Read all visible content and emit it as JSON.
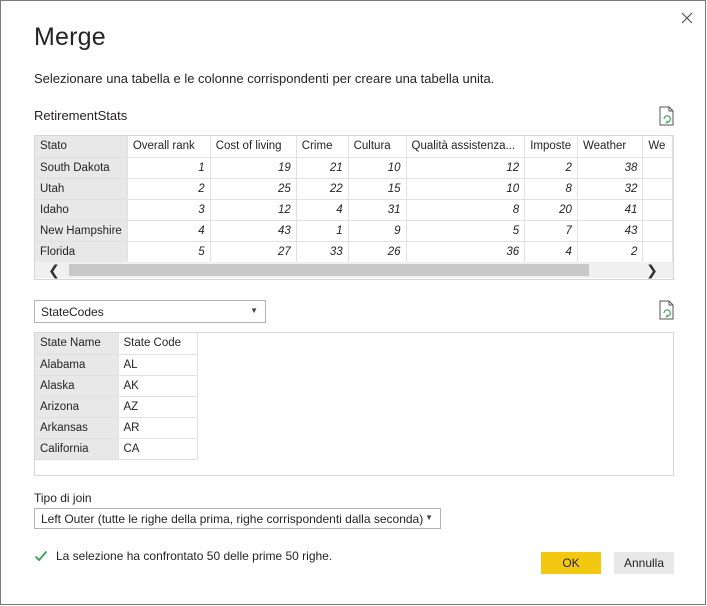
{
  "dialog": {
    "title": "Merge",
    "subtitle": "Selezionare una tabella e le colonne corrispondenti per creare una tabella unita."
  },
  "table1": {
    "name": "RetirementStats",
    "columns": [
      "Stato",
      "Overall rank",
      "Cost of living",
      "Crime",
      "Cultura",
      "Qualità assistenza...",
      "Imposte",
      "Weather",
      "We"
    ],
    "rows": [
      [
        "South Dakota",
        "1",
        "19",
        "21",
        "10",
        "12",
        "2",
        "38",
        ""
      ],
      [
        "Utah",
        "2",
        "25",
        "22",
        "15",
        "10",
        "8",
        "32",
        ""
      ],
      [
        "Idaho",
        "3",
        "12",
        "4",
        "31",
        "8",
        "20",
        "41",
        ""
      ],
      [
        "New Hampshire",
        "4",
        "43",
        "1",
        "9",
        "5",
        "7",
        "43",
        ""
      ],
      [
        "Florida",
        "5",
        "27",
        "33",
        "26",
        "36",
        "4",
        "2",
        ""
      ]
    ]
  },
  "table2_select": {
    "selected": "StateCodes"
  },
  "table2": {
    "columns": [
      "State Name",
      "State Code"
    ],
    "rows": [
      [
        "Alabama",
        "AL"
      ],
      [
        "Alaska",
        "AK"
      ],
      [
        "Arizona",
        "AZ"
      ],
      [
        "Arkansas",
        "AR"
      ],
      [
        "California",
        "CA"
      ]
    ]
  },
  "join": {
    "label": "Tipo di join",
    "selected": "Left Outer (tutte le righe della prima, righe corrispondenti dalla seconda)"
  },
  "status": {
    "text": "La selezione ha confrontato 50 delle prime 50 righe.",
    "icon": "check-icon",
    "color": "#3c9e5b"
  },
  "buttons": {
    "ok": "OK",
    "cancel": "Annulla"
  },
  "colors": {
    "accent": "#f2c811",
    "row_header_bg": "#e8e8e8"
  }
}
